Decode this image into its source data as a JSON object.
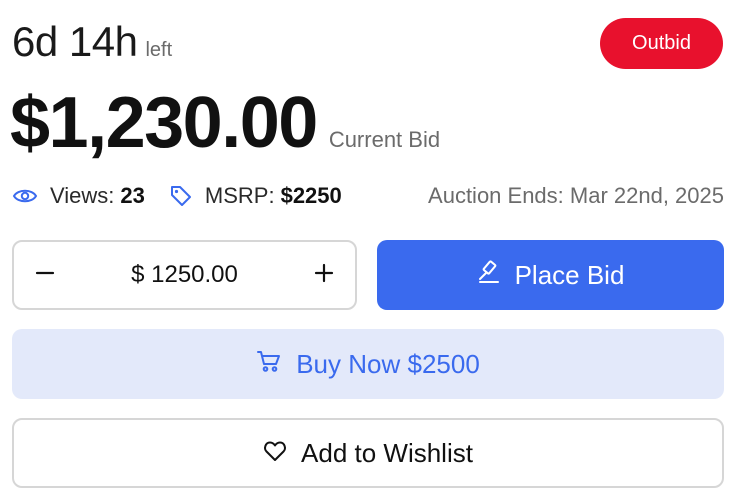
{
  "countdown": {
    "value": "6d 14h",
    "suffix": "left"
  },
  "status_badge": {
    "label": "Outbid",
    "color": "#e8112d"
  },
  "price": {
    "amount": "$1,230.00",
    "label": "Current Bid"
  },
  "meta": {
    "views_label": "Views:",
    "views_value": "23",
    "msrp_label": "MSRP:",
    "msrp_value": "$2250",
    "auction_ends": "Auction Ends: Mar 22nd, 2025"
  },
  "bid_input": {
    "value": "$ 1250.00",
    "decrement_icon": "minus-icon",
    "increment_icon": "plus-icon"
  },
  "place_bid": {
    "label": "Place Bid",
    "icon": "gavel-icon",
    "color": "#3a6aee"
  },
  "buy_now": {
    "label": "Buy Now $2500",
    "icon": "cart-icon",
    "background": "#e3e9fa"
  },
  "wishlist": {
    "label": "Add to Wishlist",
    "icon": "heart-icon"
  }
}
